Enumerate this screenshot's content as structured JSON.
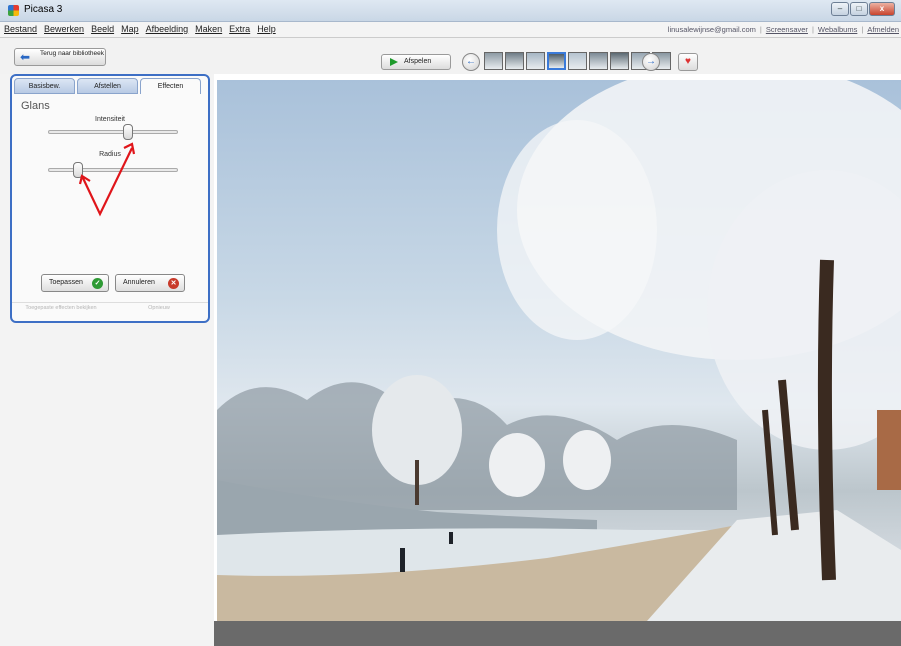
{
  "window": {
    "title": "Picasa 3",
    "controls": [
      "–",
      "□",
      "x"
    ]
  },
  "menu": {
    "items": [
      "Bestand",
      "Bewerken",
      "Beeld",
      "Map",
      "Afbeelding",
      "Maken",
      "Extra",
      "Help"
    ],
    "right": {
      "account": "linusalewijnse@gmail.com",
      "screensaver": "Screensaver",
      "webalbums": "Webalbums",
      "signout": "Afmelden"
    }
  },
  "toolbar": {
    "back_label": "Terug naar bibliotheek",
    "play_label": "Afspelen",
    "prev_icon": "arrow-left-icon",
    "next_icon": "arrow-right-icon",
    "thumbnails": [
      "#8d9aa4",
      "#6f7d87",
      "#a6b6c4",
      "#4e5d68",
      "#b5c3cf",
      "#7c8a95",
      "#5c6a73",
      "#96a5b1",
      "#8896a0"
    ],
    "selected_thumb": 3
  },
  "panel": {
    "tabs": [
      "Basisbew.",
      "Afstellen",
      "Effecten"
    ],
    "active_tab": 2,
    "effect_name": "Glans",
    "sliders": [
      {
        "label": "Intensiteit",
        "value": 0.62
      },
      {
        "label": "Radius",
        "value": 0.2
      }
    ],
    "apply_label": "Toepassen",
    "cancel_label": "Annuleren",
    "disabled_left": "Toegepaste effecten bekijken",
    "disabled_right": "Opnieuw"
  },
  "colors": {
    "accent": "#3d6fc5",
    "apply": "#2e9a34",
    "cancel": "#c83a2a"
  }
}
